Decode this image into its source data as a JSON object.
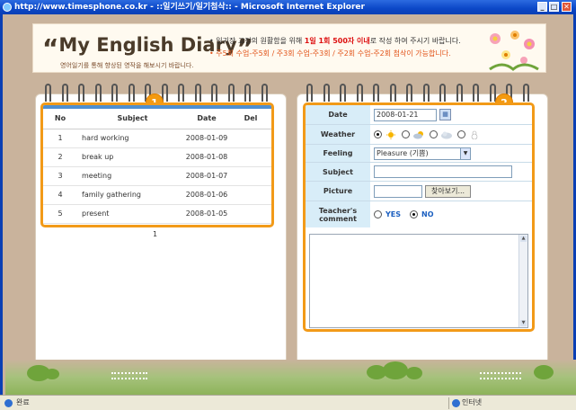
{
  "window": {
    "title": "http://www.timesphone.co.kr - ::일기쓰기/일기첨삭:: - Microsoft Internet Explorer",
    "min": "_",
    "max": "□",
    "close": "✕"
  },
  "banner": {
    "title": "My English Diary",
    "quote_open": "“",
    "quote_close": "”",
    "subtitle": "영어일기를 통해 향상된 영작을 해보시기 바랍니다.",
    "notice1_pre": "• 일기장 교정의 원활함을 위해 ",
    "notice1_red": "1일 1회 500자 이내",
    "notice1_post": "로 작성 하여 주시기 바랍니다.",
    "notice2": "• 주5회 수업-주5회 / 주3회 수업-주3회 / 주2회 수업-주2회 첨삭이 가능합니다."
  },
  "left_panel": {
    "badge": "1",
    "columns": [
      "No",
      "Subject",
      "Date",
      "Del"
    ],
    "rows": [
      {
        "no": "1",
        "subject": "hard working",
        "date": "2008-01-09"
      },
      {
        "no": "2",
        "subject": "break up",
        "date": "2008-01-08"
      },
      {
        "no": "3",
        "subject": "meeting",
        "date": "2008-01-07"
      },
      {
        "no": "4",
        "subject": "family gathering",
        "date": "2008-01-06"
      },
      {
        "no": "5",
        "subject": "present",
        "date": "2008-01-05"
      }
    ],
    "page": "1"
  },
  "right_panel": {
    "badge": "2",
    "labels": {
      "date": "Date",
      "weather": "Weather",
      "feeling": "Feeling",
      "subject": "Subject",
      "picture": "Picture",
      "teacher_comment": "Teacher's comment"
    },
    "date_value": "2008-01-21",
    "feeling_selected": "Pleasure (기쁨)",
    "browse_button": "찾아보기...",
    "yes": "YES",
    "no": "NO",
    "weather_icons": [
      "sun-icon",
      "cloud-sun-icon",
      "cloud-icon",
      "snowman-icon"
    ]
  },
  "status": {
    "left": "완료",
    "right": "인터넷"
  }
}
